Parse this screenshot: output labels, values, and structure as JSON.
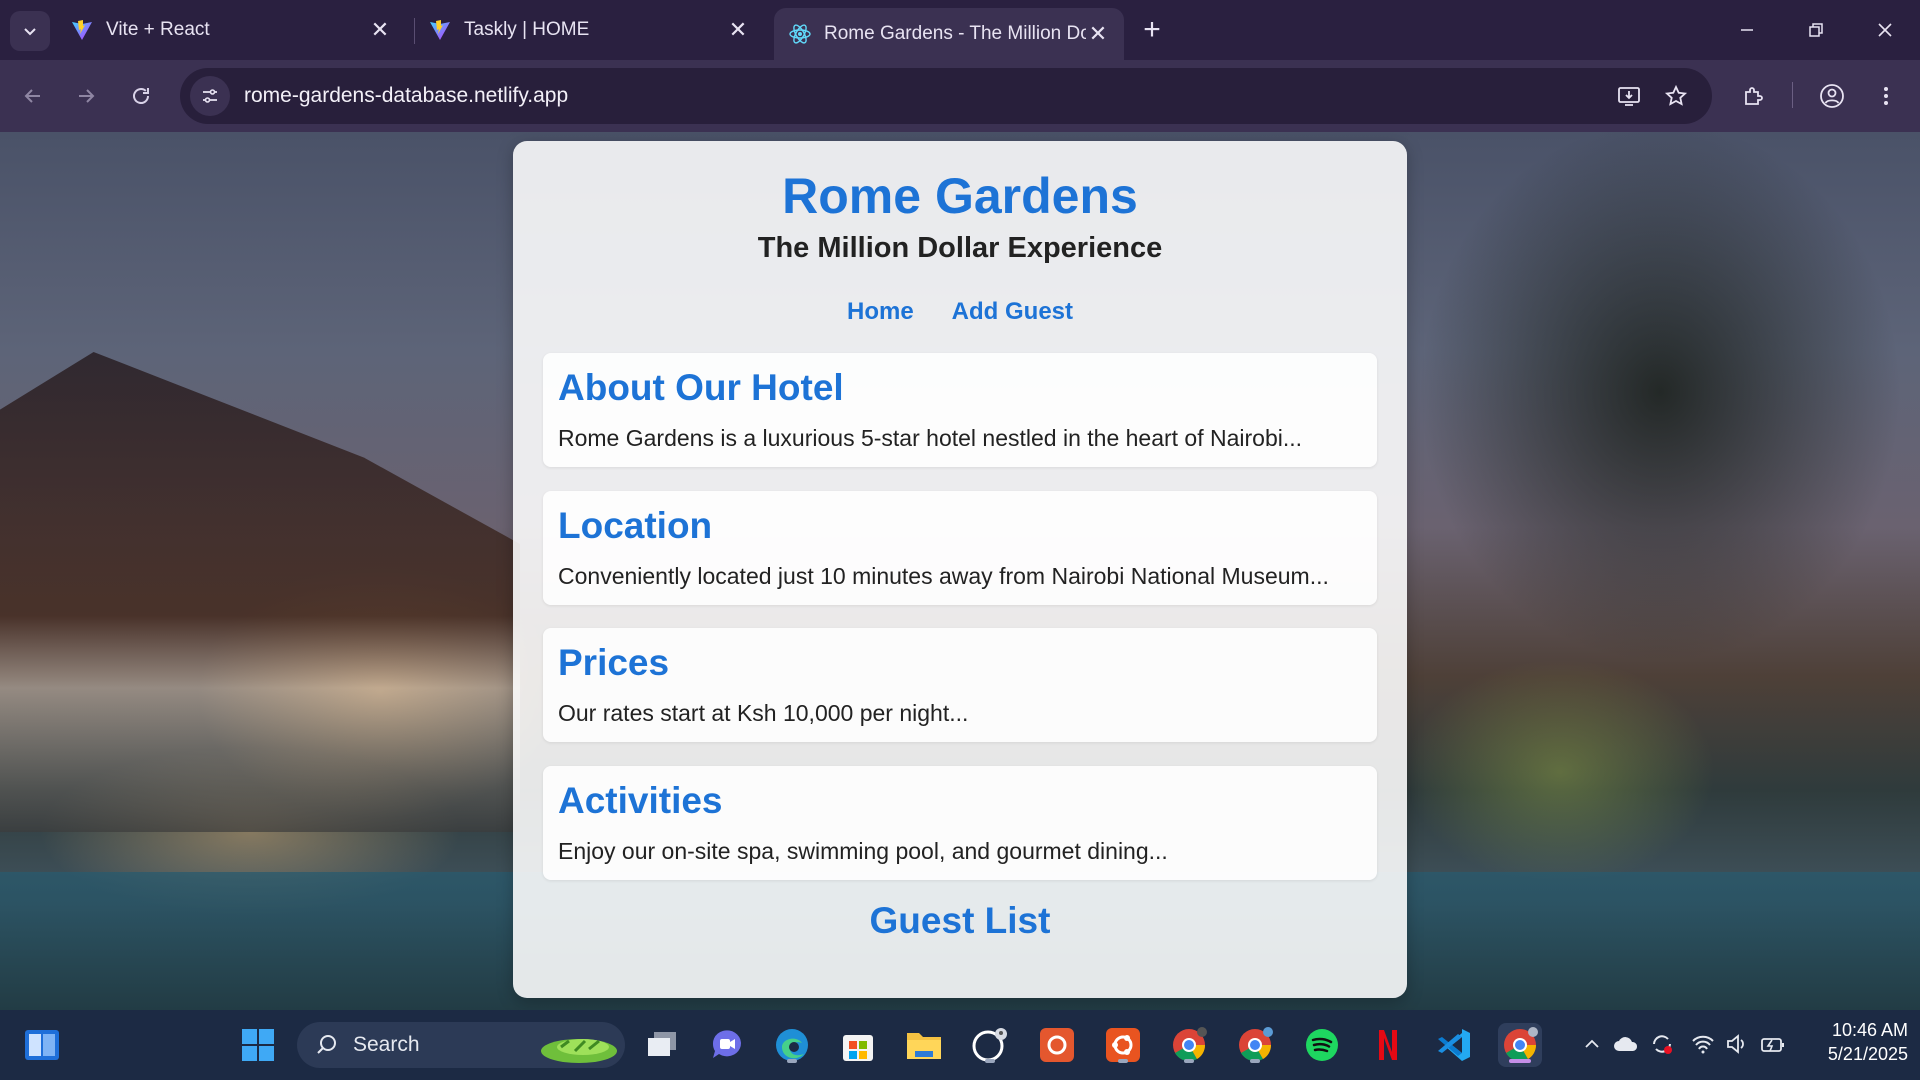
{
  "browser": {
    "tabs": [
      {
        "title": "Vite + React",
        "icon": "vite-icon"
      },
      {
        "title": "Taskly | HOME",
        "icon": "vite-icon"
      },
      {
        "title": "Rome Gardens - The Million Do",
        "icon": "react-icon",
        "active": true
      }
    ],
    "url": "rome-gardens-database.netlify.app"
  },
  "app": {
    "title": "Rome Gardens",
    "subtitle": "The Million Dollar Experience",
    "nav": [
      "Home",
      "Add Guest"
    ],
    "sections": [
      {
        "heading": "About Our Hotel",
        "text": "Rome Gardens is a luxurious 5-star hotel nestled in the heart of Nairobi..."
      },
      {
        "heading": "Location",
        "text": "Conveniently located just 10 minutes away from Nairobi National Museum..."
      },
      {
        "heading": "Prices",
        "text": "Our rates start at Ksh 10,000 per night..."
      },
      {
        "heading": "Activities",
        "text": "Enjoy our on-site spa, swimming pool, and gourmet dining..."
      }
    ],
    "guest_list_heading": "Guest List",
    "accent_color": "#1d73d6"
  },
  "taskbar": {
    "search_label": "Search",
    "time": "10:46 AM",
    "date": "5/21/2025"
  }
}
